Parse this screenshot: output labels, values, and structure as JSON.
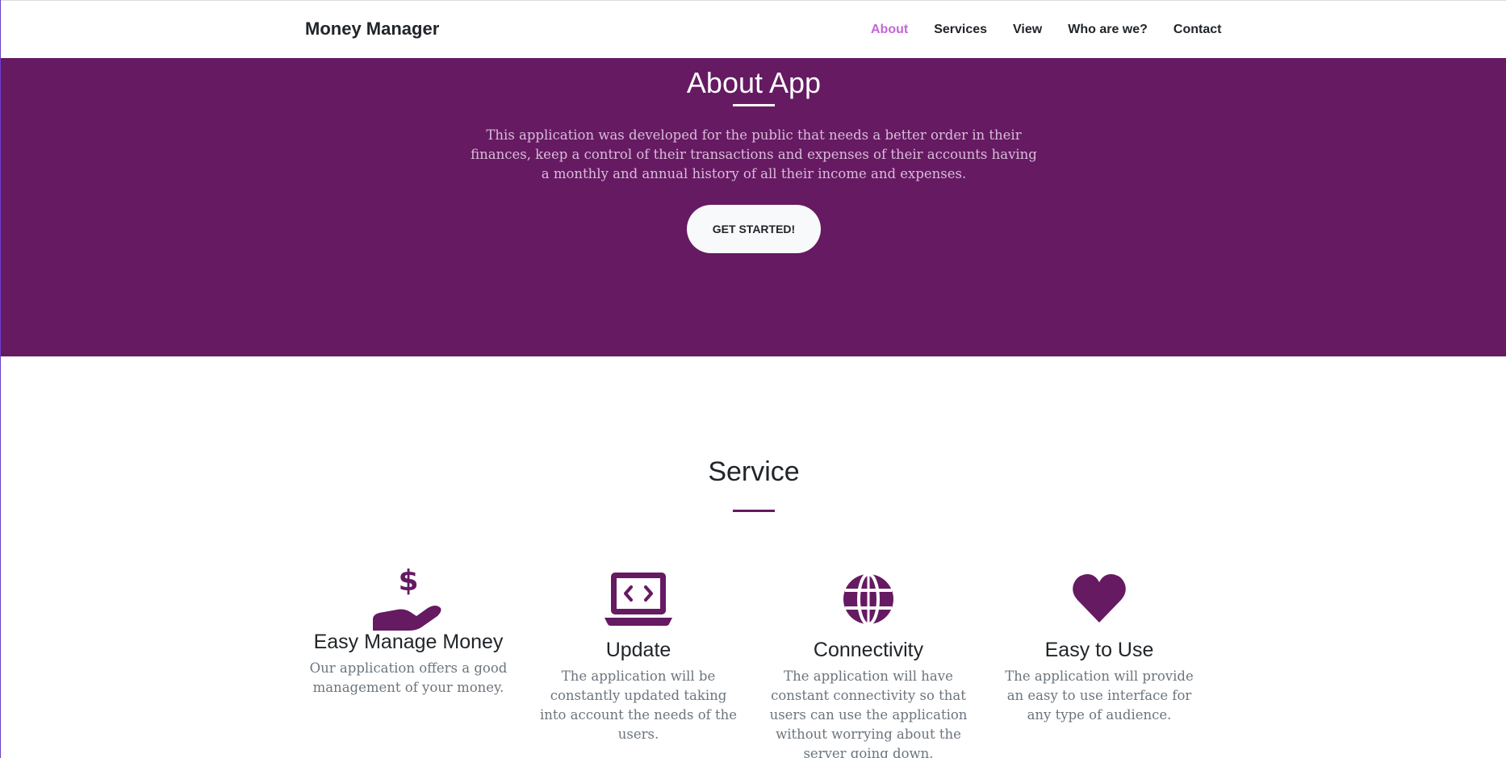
{
  "navbar": {
    "brand": "Money Manager",
    "links": [
      {
        "label": "About",
        "active": true
      },
      {
        "label": "Services",
        "active": false
      },
      {
        "label": "View",
        "active": false
      },
      {
        "label": "Who are we?",
        "active": false
      },
      {
        "label": "Contact",
        "active": false
      }
    ]
  },
  "hero": {
    "title": "About App",
    "description": "This application was developed for the public that needs a better order in their finances, keep a control of their transactions and expenses of their accounts having a monthly and annual history of all their income and expenses.",
    "button_label": "GET STARTED!"
  },
  "services": {
    "title": "Service",
    "items": [
      {
        "icon": "hand-holding-dollar-icon",
        "title": "Easy Manage Money",
        "text": "Our application offers a good management of your money."
      },
      {
        "icon": "laptop-code-icon",
        "title": "Update",
        "text": "The application will be constantly updated taking into account the needs of the users."
      },
      {
        "icon": "globe-icon",
        "title": "Connectivity",
        "text": "The application will have constant connectivity so that users can use the application without worrying about the server going down."
      },
      {
        "icon": "heart-icon",
        "title": "Easy to Use",
        "text": "The application will provide an easy to use interface for any type of audience."
      }
    ]
  },
  "colors": {
    "primary": "#651a62",
    "nav_active": "#c366d8",
    "hero_text": "#d9bcd8",
    "muted_text": "#6c757d"
  }
}
